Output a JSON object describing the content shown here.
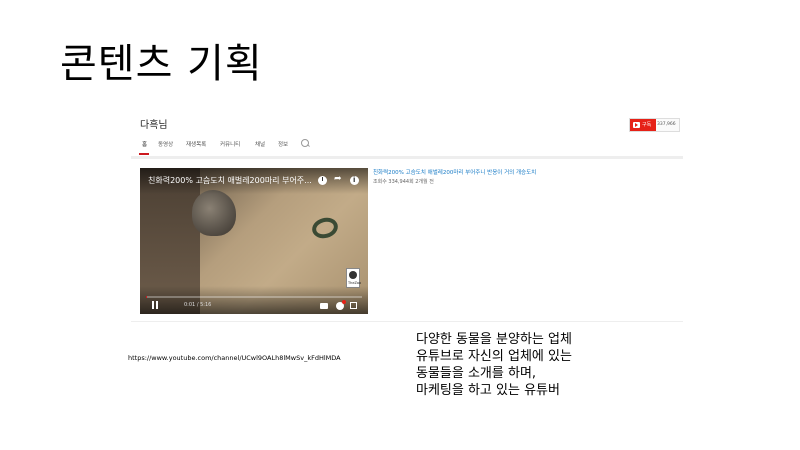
{
  "slide": {
    "title": "콘텐츠 기획",
    "url": "https://www.youtube.com/channel/UCwl9OALh8lMwSv_kFdHlMDA",
    "description": [
      "다양한 동물을 분양하는 업체",
      "유튜브로 자신의 업체에 있는",
      "동물들을 소개를 하며,",
      "마케팅을 하고 있는 유튜버"
    ]
  },
  "youtube": {
    "channel_name": "다흑님",
    "subscribe": {
      "label": "구독",
      "count": "337,966"
    },
    "tabs": [
      "홈",
      "동영상",
      "재생목록",
      "커뮤니티",
      "채널",
      "정보"
    ],
    "active_tab_index": 0,
    "video": {
      "overlay_title": "친화력200% 고슴도치 애벌레200마리 부어주...",
      "time": "0:01 / 5:16",
      "progress_fraction": 0.003,
      "watermark": "TheZoo",
      "link_title": "친화력200% 고슴도치 애벌레200마리 부어주니 반응이 거의 개승도치",
      "meta": "조회수 334,944회 2개월 전"
    },
    "colors": {
      "brand_red": "#e62117",
      "link_blue": "#167ac6"
    }
  }
}
